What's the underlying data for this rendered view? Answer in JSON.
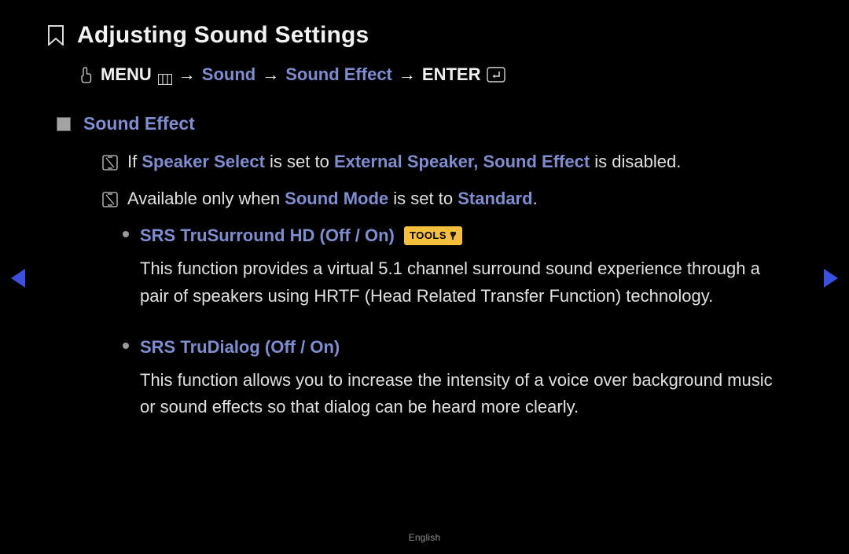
{
  "title": "Adjusting Sound Settings",
  "breadcrumb": {
    "menu": "MENU",
    "arrow": "→",
    "path1": "Sound",
    "path2": "Sound Effect",
    "enter": "ENTER"
  },
  "section": {
    "heading": "Sound Effect",
    "note1_pre": "If ",
    "note1_b1": "Speaker Select",
    "note1_mid": " is set to ",
    "note1_b2": "External Speaker, Sound Effect",
    "note1_post": " is disabled.",
    "note2_pre": "Available only when ",
    "note2_b1": "Sound Mode",
    "note2_mid": " is set to ",
    "note2_b2": "Standard",
    "note2_post": "."
  },
  "items": [
    {
      "heading": "SRS TruSurround HD (Off / On)",
      "tools_label": "TOOLS",
      "body": "This function provides a virtual 5.1 channel surround sound experience through a pair of speakers using HRTF (Head Related Transfer Function) technology."
    },
    {
      "heading": "SRS TruDialog (Off / On)",
      "body": "This function allows you to increase the intensity of a voice over background music or sound effects so that dialog can be heard more clearly."
    }
  ],
  "footer": "English"
}
